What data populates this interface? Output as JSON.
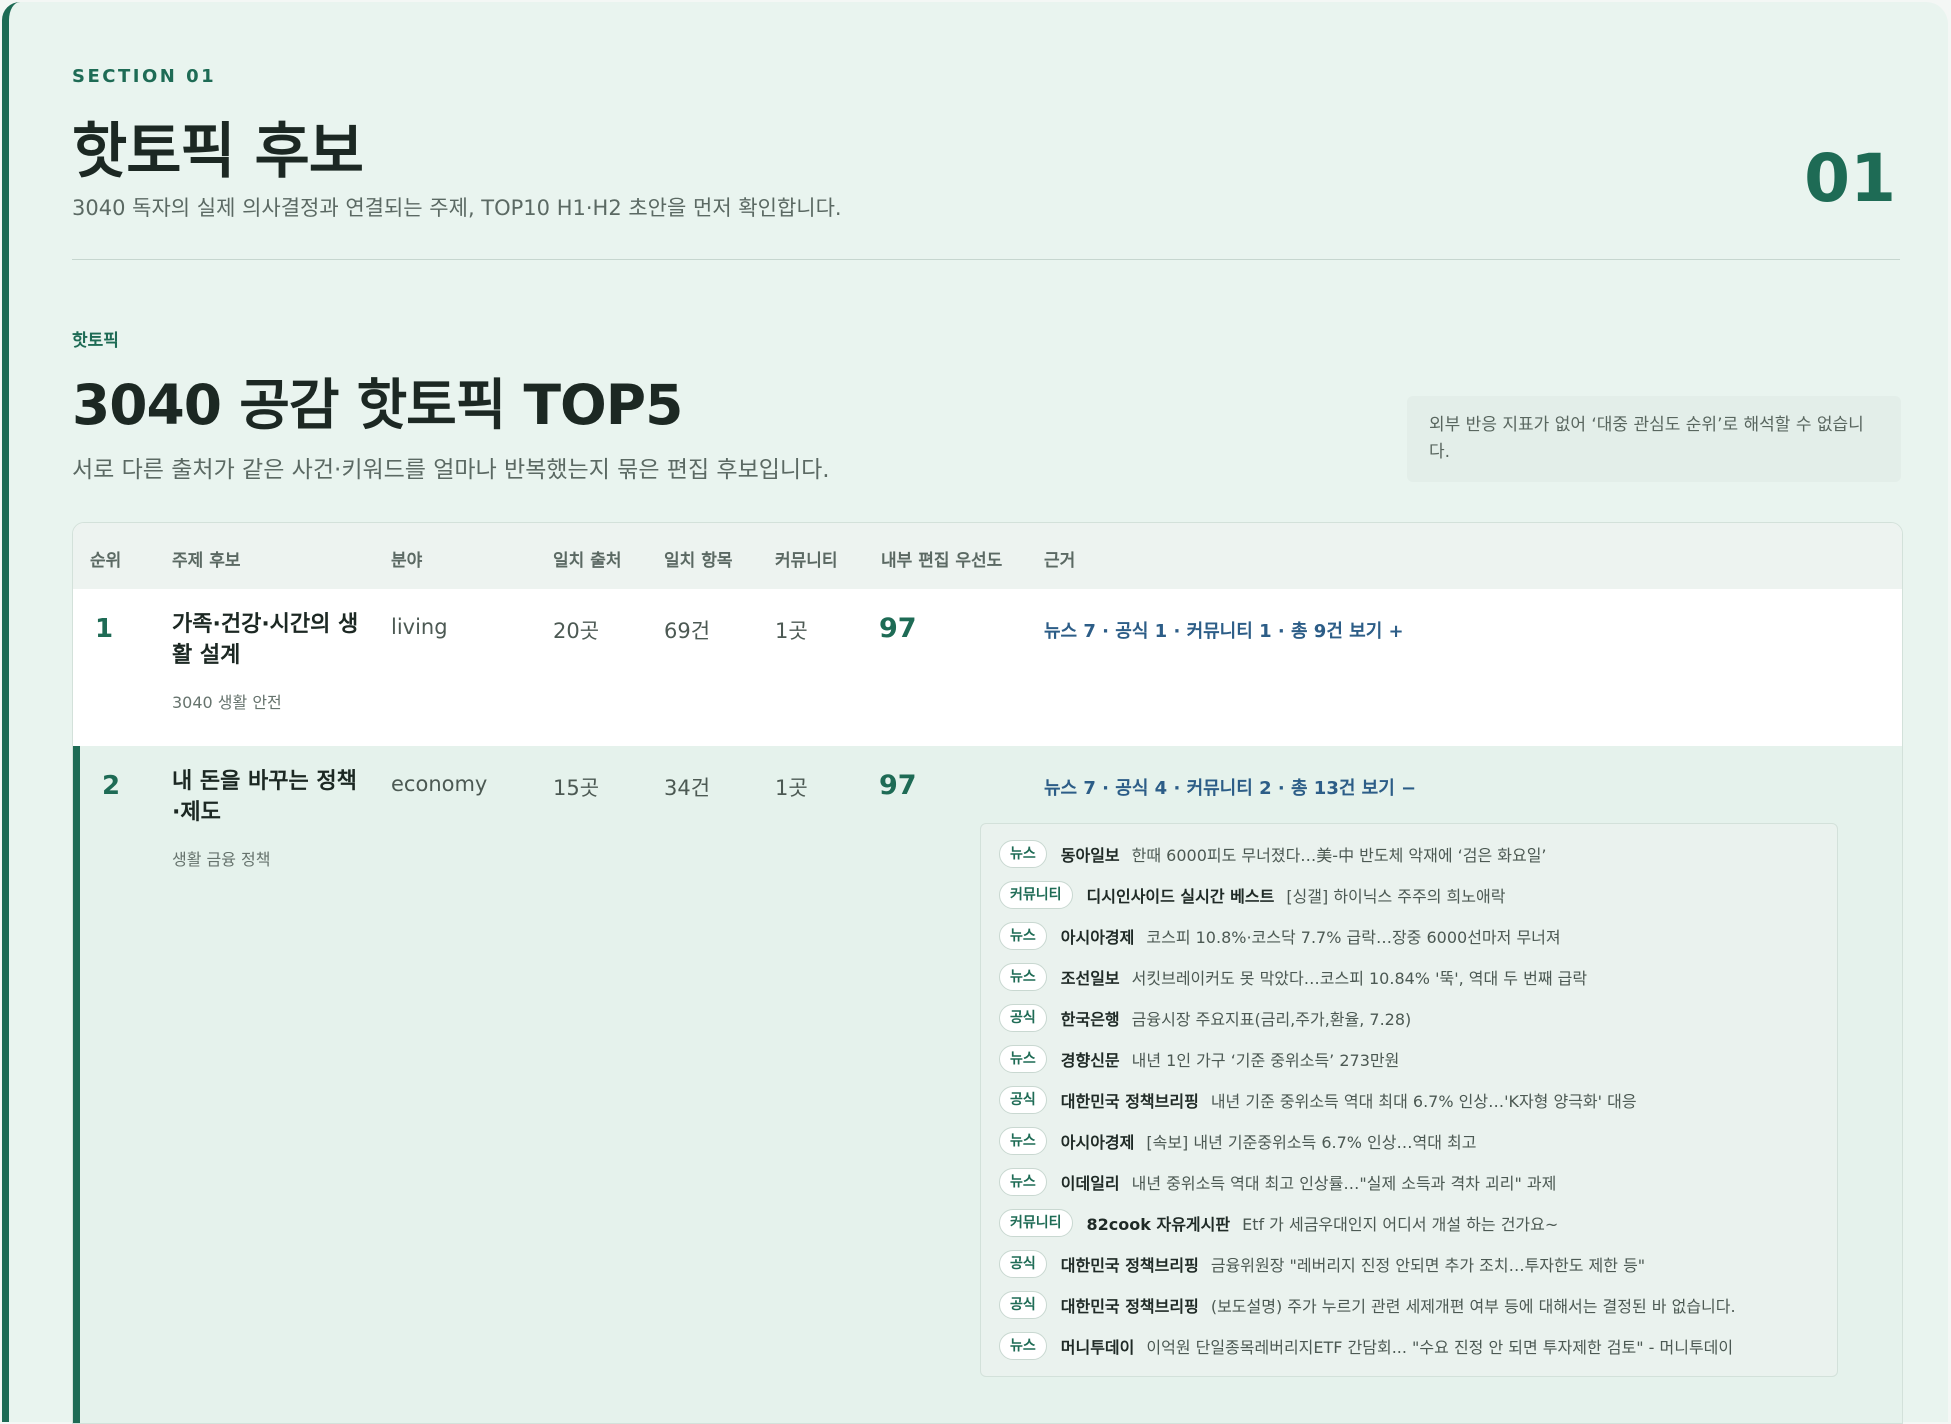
{
  "section": {
    "label": "SECTION 01",
    "title": "핫토픽 후보",
    "description": "3040 독자의 실제 의사결정과 연결되는 주제, TOP10 H1·H2 초안을 먼저 확인합니다.",
    "number": "01"
  },
  "hot": {
    "label": "핫토픽",
    "title": "3040 공감 핫토픽 TOP5",
    "description": "서로 다른 출처가 같은 사건·키워드를 얼마나 반복했는지 묶은 편집 후보입니다.",
    "note": "외부 반응 지표가 없어 ‘대중 관심도 순위’로 해석할 수 없습니다."
  },
  "table": {
    "headers": [
      "순위",
      "주제 후보",
      "분야",
      "일치 출처",
      "일치 항목",
      "커뮤니티",
      "내부 편집 우선도",
      "근거"
    ],
    "rows": [
      {
        "rank": "1",
        "topic": "가족·건강·시간의 생활 설계",
        "subtitle": "3040 생활 안전",
        "field": "living",
        "sources": "20곳",
        "items": "69건",
        "community": "1곳",
        "priority": "97",
        "basis": "뉴스 7 · 공식 1 · 커뮤니티 1 · 총 9건 보기 +"
      },
      {
        "rank": "2",
        "topic": "내 돈을 바꾸는 정책·제도",
        "subtitle": "생활 금융 정책",
        "field": "economy",
        "sources": "15곳",
        "items": "34건",
        "community": "1곳",
        "priority": "97",
        "basis": "뉴스 7 · 공식 4 · 커뮤니티 2 · 총 13건 보기 −",
        "evidence": [
          {
            "type": "뉴스",
            "source": "동아일보",
            "title": "한때 6000피도 무너졌다…美-中 반도체 악재에 ‘검은 화요일’"
          },
          {
            "type": "커뮤니티",
            "source": "디시인사이드 실시간 베스트",
            "title": "[싱갤] 하이닉스 주주의 희노애락"
          },
          {
            "type": "뉴스",
            "source": "아시아경제",
            "title": "코스피 10.8%·코스닥 7.7% 급락…장중 6000선마저 무너져"
          },
          {
            "type": "뉴스",
            "source": "조선일보",
            "title": "서킷브레이커도 못 막았다…코스피 10.84% '뚝', 역대 두 번째 급락"
          },
          {
            "type": "공식",
            "source": "한국은행",
            "title": "금융시장 주요지표(금리,주가,환율, 7.28)"
          },
          {
            "type": "뉴스",
            "source": "경향신문",
            "title": "내년 1인 가구 ‘기준 중위소득’ 273만원"
          },
          {
            "type": "공식",
            "source": "대한민국 정책브리핑",
            "title": "내년 기준 중위소득 역대 최대 6.7% 인상…'K자형 양극화' 대응"
          },
          {
            "type": "뉴스",
            "source": "아시아경제",
            "title": "[속보] 내년 기준중위소득 6.7% 인상…역대 최고"
          },
          {
            "type": "뉴스",
            "source": "이데일리",
            "title": "내년 중위소득 역대 최고 인상률…\"실제 소득과 격차 괴리\" 과제"
          },
          {
            "type": "커뮤니티",
            "source": "82cook 자유게시판",
            "title": "Etf 가 세금우대인지 어디서 개설 하는 건가요~"
          },
          {
            "type": "공식",
            "source": "대한민국 정책브리핑",
            "title": "금융위원장 \"레버리지 진정 안되면 추가 조치…투자한도 제한 등\""
          },
          {
            "type": "공식",
            "source": "대한민국 정책브리핑",
            "title": "(보도설명) 주가 누르기 관련 세제개편 여부 등에 대해서는 결정된 바 없습니다."
          },
          {
            "type": "뉴스",
            "source": "머니투데이",
            "title": "이억원 단일종목레버리지ETF 간담회... \"수요 진정 안 되면 투자제한 검토\" - 머니투데이"
          }
        ]
      }
    ]
  },
  "colors": {
    "accent": "#1e6b55",
    "link": "#2c5d87",
    "background": "#e9f4ef"
  }
}
